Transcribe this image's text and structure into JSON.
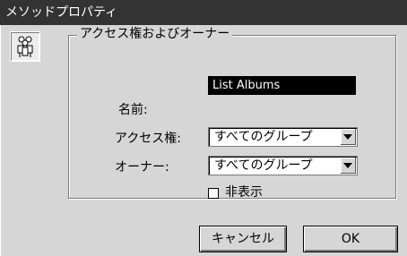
{
  "window": {
    "title": "メソッドプロパティ"
  },
  "icons": {
    "group_icon": "people-group-icon"
  },
  "group": {
    "legend": "アクセス権およびオーナー"
  },
  "form": {
    "name_label": "名前:",
    "name_value": "List Albums",
    "access_label": "アクセス権:",
    "access_value": "すべてのグループ",
    "owner_label": "オーナー:",
    "owner_value": "すべてのグループ",
    "hidden_label": "非表示",
    "hidden_checked": false
  },
  "buttons": {
    "cancel_label": "キャンセル",
    "ok_label": "OK"
  }
}
